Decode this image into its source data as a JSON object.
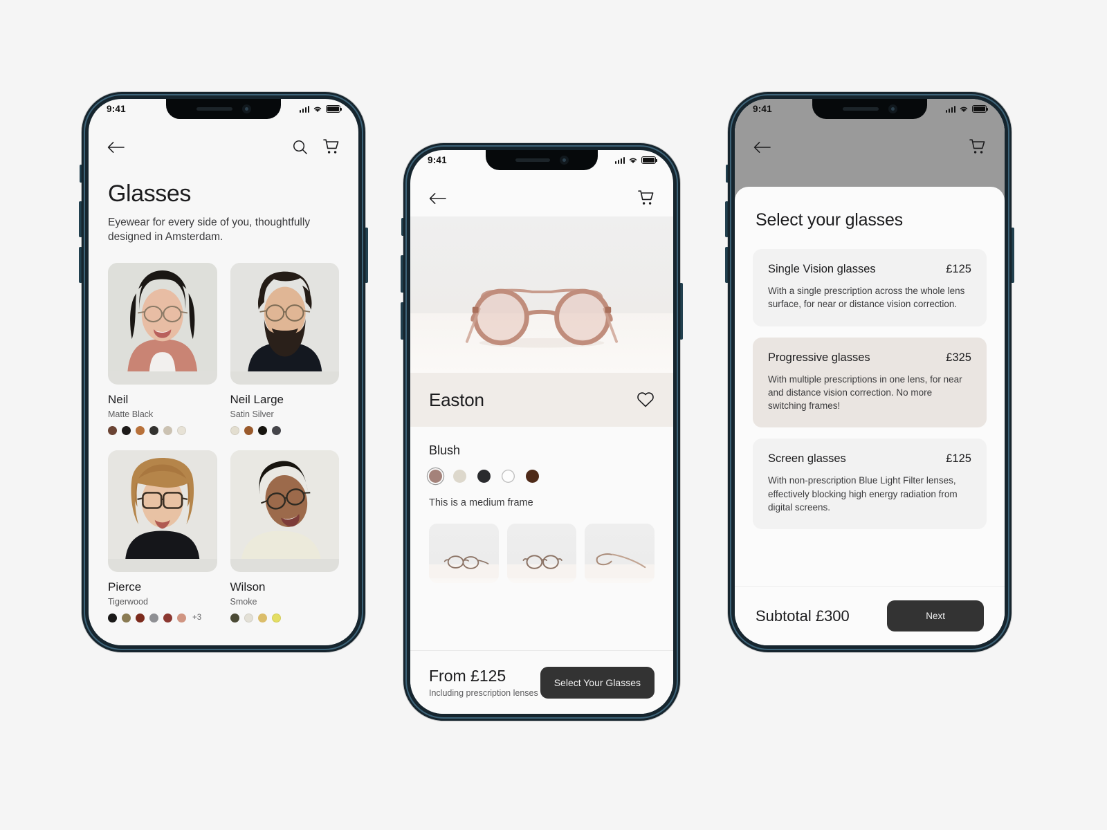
{
  "phones": {
    "statusbar": {
      "time": "9:41",
      "signal_icon": "cellular-bars-icon",
      "wifi_icon": "wifi-icon",
      "battery_icon": "battery-full-icon"
    }
  },
  "phone1": {
    "nav": {
      "back_icon": "back-arrow-icon",
      "search_icon": "search-icon",
      "cart_icon": "shopping-cart-icon"
    },
    "title": "Glasses",
    "subtitle": "Eyewear for every side of you, thoughtfully designed in Amsterdam.",
    "products": [
      {
        "name": "Neil",
        "variant": "Matte Black",
        "photo_alt": "woman-wearing-round-glasses",
        "swatches": [
          "#6b4434",
          "#1d1a19",
          "#b8713a",
          "#33322f",
          "#cbc2b2",
          "#e7e2d6"
        ],
        "more": ""
      },
      {
        "name": "Neil Large",
        "variant": "Satin Silver",
        "photo_alt": "bearded-man-wearing-round-glasses",
        "swatches": [
          "#e3ded0",
          "#9a5a2c",
          "#17150f",
          "#45454a"
        ],
        "more": ""
      },
      {
        "name": "Pierce",
        "variant": "Tigerwood",
        "photo_alt": "woman-with-bob-wearing-square-glasses",
        "swatches": [
          "#1a1918",
          "#8a7b53",
          "#7c2b1d",
          "#8f9094",
          "#8c3831",
          "#d09582"
        ],
        "more": "+3"
      },
      {
        "name": "Wilson",
        "variant": "Smoke",
        "photo_alt": "person-looking-up-wearing-glasses",
        "swatches": [
          "#4b4a35",
          "#e3e0d6",
          "#dbbd6a",
          "#e4de63"
        ],
        "more": ""
      }
    ]
  },
  "phone2": {
    "nav": {
      "back_icon": "back-arrow-icon",
      "cart_icon": "shopping-cart-icon"
    },
    "hero_alt": "blush-round-acetate-glasses-front-view",
    "product_title": "Easton",
    "favorite_icon": "heart-outline-icon",
    "color_name": "Blush",
    "color_swatches": [
      {
        "name": "blush",
        "hex": "#a4827a",
        "selected": true,
        "outline": false
      },
      {
        "name": "sand",
        "hex": "#ddd8cc",
        "selected": false,
        "outline": false
      },
      {
        "name": "black",
        "hex": "#2a2b2e",
        "selected": false,
        "outline": false
      },
      {
        "name": "crystal",
        "hex": "#fdfdfd",
        "selected": false,
        "outline": true
      },
      {
        "name": "dark-brown",
        "hex": "#4e2a18",
        "selected": false,
        "outline": false
      }
    ],
    "frame_note": "This is a medium frame",
    "thumbnails": [
      {
        "alt": "glasses-three-quarter-view"
      },
      {
        "alt": "glasses-front-view"
      },
      {
        "alt": "glasses-side-temple-view"
      }
    ],
    "price": "From £125",
    "price_note": "Including prescription lenses",
    "cta_label": "Select Your Glasses"
  },
  "phone3": {
    "nav": {
      "back_icon": "back-arrow-icon",
      "cart_icon": "shopping-cart-icon"
    },
    "sheet_title": "Select your glasses",
    "options": [
      {
        "name": "Single Vision glasses",
        "price": "£125",
        "description": "With a single prescription across the whole lens surface, for near or distance vision correction.",
        "selected": false
      },
      {
        "name": "Progressive glasses",
        "price": "£325",
        "description": "With multiple prescriptions in one lens, for near and distance vision correction. No more switching frames!",
        "selected": true
      },
      {
        "name": "Screen glasses",
        "price": "£125",
        "description": "With non-prescription Blue Light Filter lenses, effectively blocking high energy radiation from digital screens.",
        "selected": false
      }
    ],
    "subtotal": "Subtotal £300",
    "next_label": "Next"
  },
  "colors": {
    "page_bg": "#f5f5f5",
    "frame": "#16252e",
    "frame_edge": "#3d6378",
    "cta_dark": "#333333",
    "selected_card": "#eae5e1",
    "card": "#f2f2f2",
    "dim_overlay": "#9a9a9a"
  }
}
